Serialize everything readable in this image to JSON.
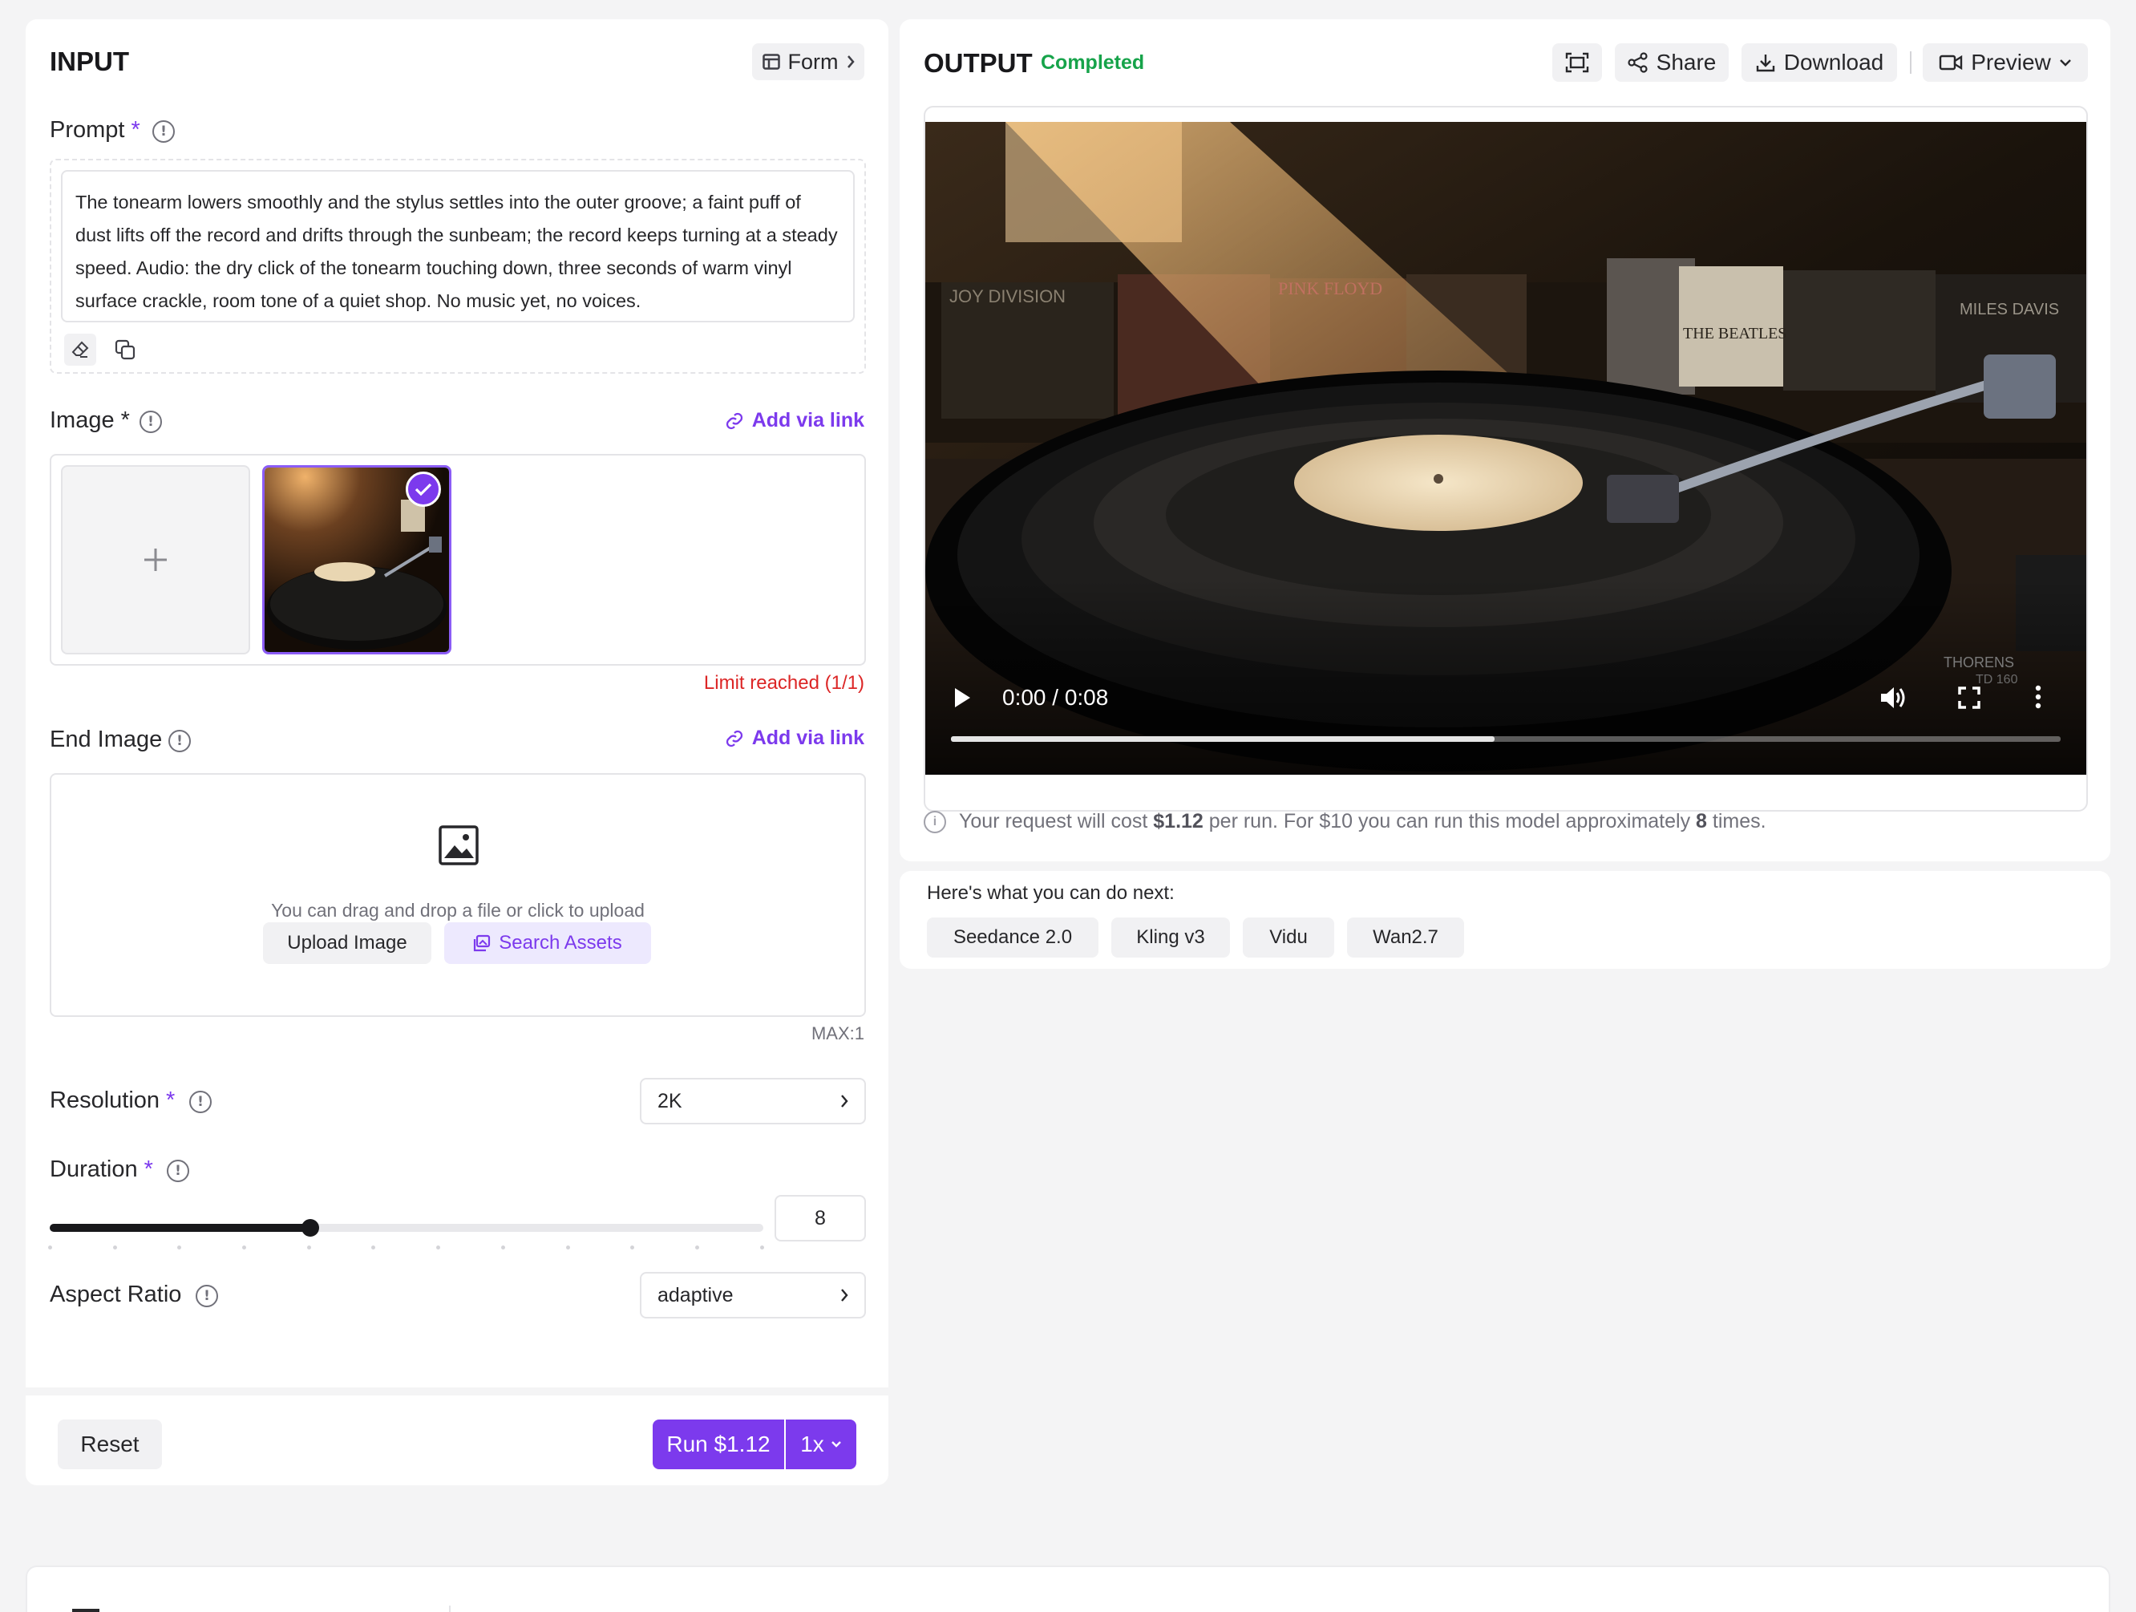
{
  "input": {
    "title": "INPUT",
    "form_label": "Form",
    "prompt": {
      "label": "Prompt",
      "required_mark": "*",
      "text": "The tonearm lowers smoothly and the stylus settles into the outer groove; a faint puff of dust lifts off the record and drifts through the sunbeam; the record keeps turning at a steady speed. Audio: the dry click of the tonearm touching down, three seconds of warm vinyl surface crackle, room tone of a quiet shop. No music yet, no voices."
    },
    "image": {
      "label": "Image",
      "required_mark": "*",
      "add_link": "Add via link",
      "limit_text": "Limit reached (1/1)"
    },
    "end_image": {
      "label": "End Image",
      "add_link": "Add via link",
      "drop_hint": "You can drag and drop a file or click to upload",
      "upload_button": "Upload Image",
      "search_button": "Search Assets",
      "max_text": "MAX:1"
    },
    "resolution": {
      "label": "Resolution",
      "required_mark": "*",
      "value": "2K"
    },
    "duration": {
      "label": "Duration",
      "required_mark": "*",
      "value": "8",
      "fraction": 0.365
    },
    "aspect_ratio": {
      "label": "Aspect Ratio",
      "value": "adaptive"
    },
    "reset_button": "Reset",
    "run_button": "Run $1.12",
    "multiplier": "1x"
  },
  "output": {
    "title": "OUTPUT",
    "status": "Completed",
    "share_label": "Share",
    "download_label": "Download",
    "preview_label": "Preview",
    "video": {
      "time": "0:00 / 0:08",
      "progress": 0.49,
      "sleeve_labels": [
        "JOY DIVISION",
        "PINK FLOYD",
        "THE BEATLES",
        "MILES DAVIS",
        "THORENS",
        "TD 160"
      ]
    },
    "cost": {
      "prefix": "Your request will cost",
      "price": "$1.12",
      "middle": "per run. For $10 you can run this model approximately",
      "count": "8",
      "suffix": "times."
    }
  },
  "next": {
    "heading": "Here's what you can do next:",
    "chips": [
      "Seedance 2.0",
      "Kling v3",
      "Vidu",
      "Wan2.7"
    ]
  },
  "colors": {
    "accent": "#7c3aed",
    "success": "#16a34a",
    "error": "#dc2626"
  }
}
